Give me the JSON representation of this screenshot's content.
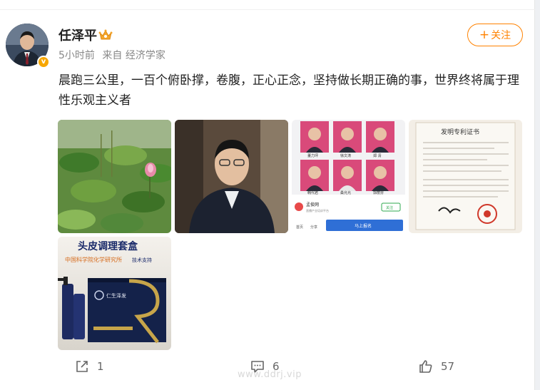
{
  "post": {
    "author": {
      "name": "任泽平",
      "avatar_icon": "avatar-photo",
      "verified_badge": "v",
      "crown_icon": "crown-icon"
    },
    "meta": {
      "time": "5小时前",
      "source": "来自 经济学家"
    },
    "follow_label": "关注",
    "follow_plus": "+",
    "text": "晨跑三公里，一百个俯卧撑，卷腹，正心正念，坚持做长期正确的事，世界终将属于理性乐观主义者",
    "images": [
      {
        "alt": "lotus-pond-photo"
      },
      {
        "alt": "speaker-portrait-photo"
      },
      {
        "alt": "lecturer-grid-screenshot",
        "app_name": "孟俊网",
        "app_sub": "直播产业培训平台",
        "follow_btn": "关注",
        "enroll_btn": "马上报名",
        "nav_home": "首页",
        "nav_share": "分享",
        "names": [
          "董力坪",
          "徐文涛",
          "郑 清",
          "韩代君",
          "桑允允",
          "郭丽芬"
        ]
      },
      {
        "alt": "patent-certificate-photo",
        "title": "发明专利证书"
      },
      {
        "alt": "scalp-care-product-photo",
        "headline": "头皮调理套盒",
        "subline": "中国科学院化学研究所",
        "subline_tail": "技术支持",
        "brand": "仁生泽发"
      }
    ]
  },
  "actions": {
    "share_count": "1",
    "comment_count": "6",
    "like_count": "57"
  },
  "watermark": "www.ddrj.vip",
  "colors": {
    "accent": "#ff8200",
    "badge": "#f7a700"
  }
}
